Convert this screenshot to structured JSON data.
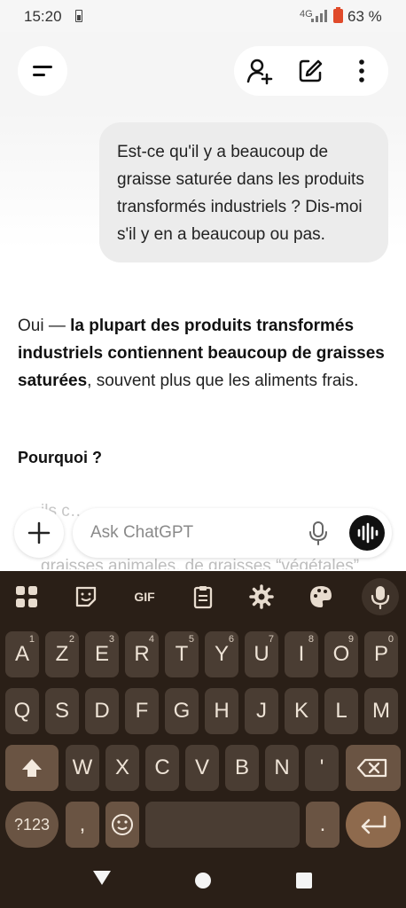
{
  "status_bar": {
    "time": "15:20",
    "network": "4G",
    "battery_percent": "63 %"
  },
  "header": {
    "menu_icon": "menu-icon",
    "actions": [
      "add-person-icon",
      "edit-icon",
      "more-vertical-icon"
    ]
  },
  "chat": {
    "user_message": "Est-ce qu'il y a beaucoup de graisse saturée dans les produits transformés industriels ? Dis-moi s'il y en a beaucoup ou pas.",
    "answer_intro": "Oui — ",
    "answer_bold": "la plupart des produits transformés industriels contiennent beaucoup de graisses saturées",
    "answer_rest": ", souvent plus que les aliments frais.",
    "section_title": "Pourquoi ?",
    "faded_line_1": "ils c…",
    "faded_line_2": "graisses animales, de graisses “végétales”"
  },
  "composer": {
    "placeholder": "Ask ChatGPT"
  },
  "keyboard": {
    "toolbar": [
      "apps-icon",
      "sticker-icon",
      "GIF",
      "clipboard-icon",
      "settings-icon",
      "palette-icon",
      "mic-icon"
    ],
    "row1": [
      {
        "k": "A",
        "n": "1"
      },
      {
        "k": "Z",
        "n": "2"
      },
      {
        "k": "E",
        "n": "3"
      },
      {
        "k": "R",
        "n": "4"
      },
      {
        "k": "T",
        "n": "5"
      },
      {
        "k": "Y",
        "n": "6"
      },
      {
        "k": "U",
        "n": "7"
      },
      {
        "k": "I",
        "n": "8"
      },
      {
        "k": "O",
        "n": "9"
      },
      {
        "k": "P",
        "n": "0"
      }
    ],
    "row2": [
      "Q",
      "S",
      "D",
      "F",
      "G",
      "H",
      "J",
      "K",
      "L",
      "M"
    ],
    "row3": [
      "W",
      "X",
      "C",
      "V",
      "B",
      "N",
      "'"
    ],
    "sym_label": "?123",
    "comma": ",",
    "period": "."
  },
  "colors": {
    "keyboard_bg": "#2a1f17",
    "key_bg": "#4a3d33",
    "enter_bg": "#8e6a4d",
    "battery": "#e04a2a"
  }
}
